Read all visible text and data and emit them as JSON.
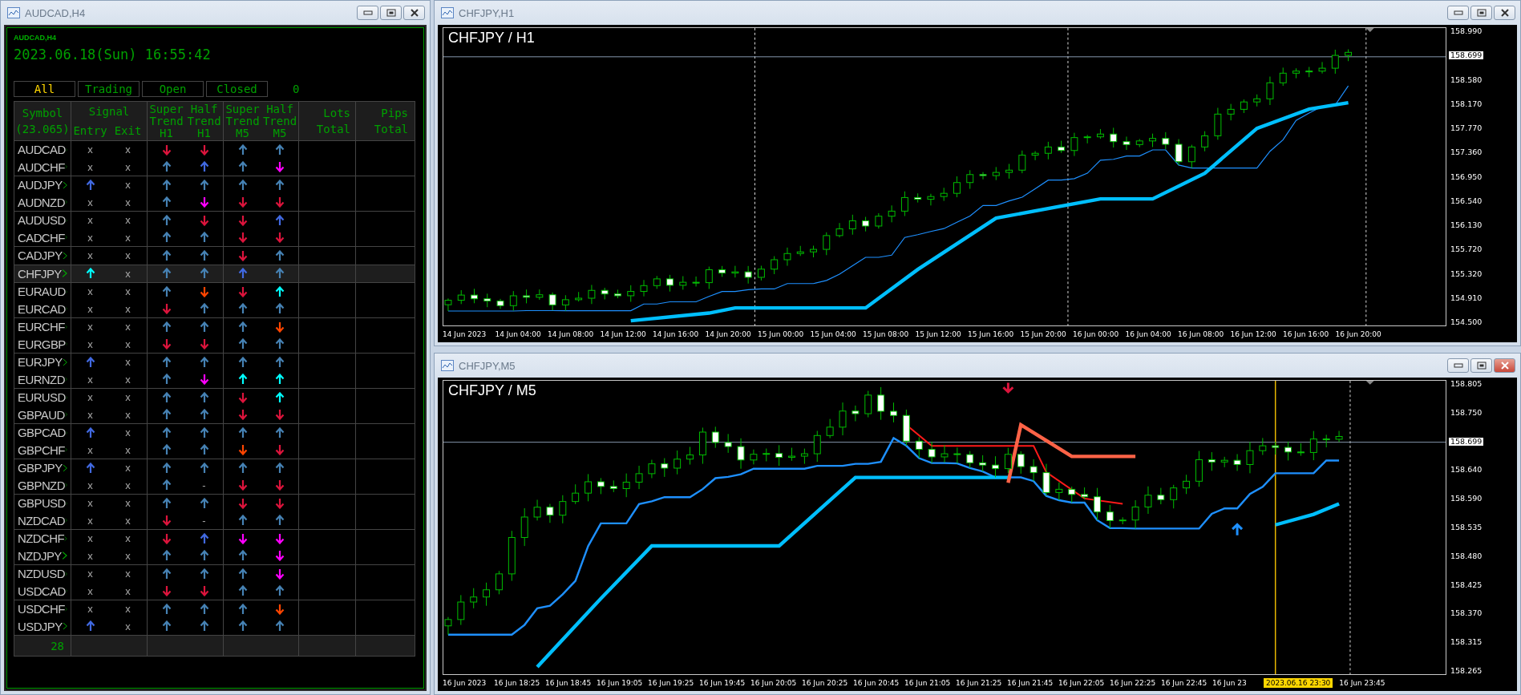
{
  "dashboard_window": {
    "title": "AUDCAD,H4",
    "caption": "AUDCAD,H4",
    "datetime": "2023.06.18(Sun) 16:55:42",
    "tabs": [
      {
        "label": "All",
        "selected": true
      },
      {
        "label": "Trading",
        "selected": false
      },
      {
        "label": "Open",
        "selected": false
      },
      {
        "label": "Closed",
        "selected": false
      }
    ],
    "count": "0",
    "table": {
      "header": {
        "symbol": [
          "Symbol",
          "(23.065)"
        ],
        "signal": "Signal",
        "signal_sub": [
          "Entry",
          "Exit"
        ],
        "indicators": [
          [
            "Super",
            "Trend",
            "H1"
          ],
          [
            "Half",
            "Trend",
            "H1"
          ],
          [
            "Super",
            "Trend",
            "M5"
          ],
          [
            "Half",
            "Trend",
            "M5"
          ]
        ],
        "totals": [
          [
            "Lots",
            "Total"
          ],
          [
            "Pips",
            "Total"
          ]
        ]
      },
      "groups": [
        {
          "rows": [
            {
              "symbol": "AUDCAD",
              "selected": false,
              "cells": [
                {
                  "kind": "text",
                  "text": "x"
                },
                {
                  "kind": "text",
                  "text": "x"
                },
                {
                  "kind": "down",
                  "color": "#dc143c"
                },
                {
                  "kind": "down",
                  "color": "#dc143c"
                },
                {
                  "kind": "up",
                  "color": "#4682b4"
                },
                {
                  "kind": "up",
                  "color": "#4682b4"
                }
              ]
            },
            {
              "symbol": "AUDCHF",
              "selected": false,
              "cells": [
                {
                  "kind": "text",
                  "text": "x"
                },
                {
                  "kind": "text",
                  "text": "x"
                },
                {
                  "kind": "up",
                  "color": "#4682b4"
                },
                {
                  "kind": "up",
                  "color": "#4169e1"
                },
                {
                  "kind": "up",
                  "color": "#4682b4"
                },
                {
                  "kind": "down",
                  "color": "#ff00ff"
                }
              ]
            }
          ]
        },
        {
          "rows": [
            {
              "symbol": "AUDJPY",
              "selected": false,
              "cells": [
                {
                  "kind": "up",
                  "color": "#4169e1"
                },
                {
                  "kind": "text",
                  "text": "x"
                },
                {
                  "kind": "up",
                  "color": "#4682b4"
                },
                {
                  "kind": "up",
                  "color": "#4682b4"
                },
                {
                  "kind": "up",
                  "color": "#4682b4"
                },
                {
                  "kind": "up",
                  "color": "#4682b4"
                }
              ]
            },
            {
              "symbol": "AUDNZD",
              "selected": false,
              "cells": [
                {
                  "kind": "text",
                  "text": "x"
                },
                {
                  "kind": "text",
                  "text": "x"
                },
                {
                  "kind": "up",
                  "color": "#4682b4"
                },
                {
                  "kind": "down",
                  "color": "#ff00ff"
                },
                {
                  "kind": "down",
                  "color": "#dc143c"
                },
                {
                  "kind": "down",
                  "color": "#dc143c"
                }
              ]
            }
          ]
        },
        {
          "rows": [
            {
              "symbol": "AUDUSD",
              "selected": false,
              "cells": [
                {
                  "kind": "text",
                  "text": "x"
                },
                {
                  "kind": "text",
                  "text": "x"
                },
                {
                  "kind": "up",
                  "color": "#4682b4"
                },
                {
                  "kind": "down",
                  "color": "#dc143c"
                },
                {
                  "kind": "down",
                  "color": "#dc143c"
                },
                {
                  "kind": "up",
                  "color": "#4169e1"
                }
              ]
            },
            {
              "symbol": "CADCHF",
              "selected": false,
              "cells": [
                {
                  "kind": "text",
                  "text": "x"
                },
                {
                  "kind": "text",
                  "text": "x"
                },
                {
                  "kind": "up",
                  "color": "#4682b4"
                },
                {
                  "kind": "up",
                  "color": "#4682b4"
                },
                {
                  "kind": "down",
                  "color": "#dc143c"
                },
                {
                  "kind": "down",
                  "color": "#dc143c"
                }
              ]
            }
          ]
        },
        {
          "rows": [
            {
              "symbol": "CADJPY",
              "selected": false,
              "cells": [
                {
                  "kind": "text",
                  "text": "x"
                },
                {
                  "kind": "text",
                  "text": "x"
                },
                {
                  "kind": "up",
                  "color": "#4682b4"
                },
                {
                  "kind": "up",
                  "color": "#4682b4"
                },
                {
                  "kind": "down",
                  "color": "#dc143c"
                },
                {
                  "kind": "up",
                  "color": "#4682b4"
                }
              ]
            }
          ]
        },
        {
          "rows": [
            {
              "symbol": "CHFJPY",
              "selected": true,
              "cells": [
                {
                  "kind": "up",
                  "color": "#00ffff"
                },
                {
                  "kind": "text",
                  "text": "x"
                },
                {
                  "kind": "up",
                  "color": "#4682b4"
                },
                {
                  "kind": "up",
                  "color": "#4682b4"
                },
                {
                  "kind": "up",
                  "color": "#4169e1"
                },
                {
                  "kind": "up",
                  "color": "#4682b4"
                }
              ]
            }
          ]
        },
        {
          "rows": [
            {
              "symbol": "EURAUD",
              "selected": false,
              "cells": [
                {
                  "kind": "text",
                  "text": "x"
                },
                {
                  "kind": "text",
                  "text": "x"
                },
                {
                  "kind": "up",
                  "color": "#4682b4"
                },
                {
                  "kind": "down",
                  "color": "#ff4500"
                },
                {
                  "kind": "down",
                  "color": "#dc143c"
                },
                {
                  "kind": "up",
                  "color": "#00ffff"
                }
              ]
            },
            {
              "symbol": "EURCAD",
              "selected": false,
              "cells": [
                {
                  "kind": "text",
                  "text": "x"
                },
                {
                  "kind": "text",
                  "text": "x"
                },
                {
                  "kind": "down",
                  "color": "#dc143c"
                },
                {
                  "kind": "up",
                  "color": "#4682b4"
                },
                {
                  "kind": "up",
                  "color": "#4682b4"
                },
                {
                  "kind": "up",
                  "color": "#4682b4"
                }
              ]
            }
          ]
        },
        {
          "rows": [
            {
              "symbol": "EURCHF",
              "selected": false,
              "cells": [
                {
                  "kind": "text",
                  "text": "x"
                },
                {
                  "kind": "text",
                  "text": "x"
                },
                {
                  "kind": "up",
                  "color": "#4682b4"
                },
                {
                  "kind": "up",
                  "color": "#4682b4"
                },
                {
                  "kind": "up",
                  "color": "#4682b4"
                },
                {
                  "kind": "down",
                  "color": "#ff4500"
                }
              ]
            },
            {
              "symbol": "EURGBP",
              "selected": false,
              "cells": [
                {
                  "kind": "text",
                  "text": "x"
                },
                {
                  "kind": "text",
                  "text": "x"
                },
                {
                  "kind": "down",
                  "color": "#dc143c"
                },
                {
                  "kind": "down",
                  "color": "#dc143c"
                },
                {
                  "kind": "up",
                  "color": "#4682b4"
                },
                {
                  "kind": "up",
                  "color": "#4682b4"
                }
              ]
            }
          ]
        },
        {
          "rows": [
            {
              "symbol": "EURJPY",
              "selected": false,
              "cells": [
                {
                  "kind": "up",
                  "color": "#4169e1"
                },
                {
                  "kind": "text",
                  "text": "x"
                },
                {
                  "kind": "up",
                  "color": "#4682b4"
                },
                {
                  "kind": "up",
                  "color": "#4682b4"
                },
                {
                  "kind": "up",
                  "color": "#4682b4"
                },
                {
                  "kind": "up",
                  "color": "#4682b4"
                }
              ]
            },
            {
              "symbol": "EURNZD",
              "selected": false,
              "cells": [
                {
                  "kind": "text",
                  "text": "x"
                },
                {
                  "kind": "text",
                  "text": "x"
                },
                {
                  "kind": "up",
                  "color": "#4682b4"
                },
                {
                  "kind": "down",
                  "color": "#ff00ff"
                },
                {
                  "kind": "up",
                  "color": "#00ffff"
                },
                {
                  "kind": "up",
                  "color": "#00ffff"
                }
              ]
            }
          ]
        },
        {
          "rows": [
            {
              "symbol": "EURUSD",
              "selected": false,
              "cells": [
                {
                  "kind": "text",
                  "text": "x"
                },
                {
                  "kind": "text",
                  "text": "x"
                },
                {
                  "kind": "up",
                  "color": "#4682b4"
                },
                {
                  "kind": "up",
                  "color": "#4682b4"
                },
                {
                  "kind": "down",
                  "color": "#dc143c"
                },
                {
                  "kind": "up",
                  "color": "#00ffff"
                }
              ]
            },
            {
              "symbol": "GBPAUD",
              "selected": false,
              "cells": [
                {
                  "kind": "text",
                  "text": "x"
                },
                {
                  "kind": "text",
                  "text": "x"
                },
                {
                  "kind": "up",
                  "color": "#4682b4"
                },
                {
                  "kind": "up",
                  "color": "#4682b4"
                },
                {
                  "kind": "down",
                  "color": "#dc143c"
                },
                {
                  "kind": "down",
                  "color": "#dc143c"
                }
              ]
            }
          ]
        },
        {
          "rows": [
            {
              "symbol": "GBPCAD",
              "selected": false,
              "cells": [
                {
                  "kind": "up",
                  "color": "#4169e1"
                },
                {
                  "kind": "text",
                  "text": "x"
                },
                {
                  "kind": "up",
                  "color": "#4682b4"
                },
                {
                  "kind": "up",
                  "color": "#4682b4"
                },
                {
                  "kind": "up",
                  "color": "#4682b4"
                },
                {
                  "kind": "up",
                  "color": "#4682b4"
                }
              ]
            },
            {
              "symbol": "GBPCHF",
              "selected": false,
              "cells": [
                {
                  "kind": "text",
                  "text": "x"
                },
                {
                  "kind": "text",
                  "text": "x"
                },
                {
                  "kind": "up",
                  "color": "#4682b4"
                },
                {
                  "kind": "up",
                  "color": "#4682b4"
                },
                {
                  "kind": "down",
                  "color": "#ff4500"
                },
                {
                  "kind": "down",
                  "color": "#dc143c"
                }
              ]
            }
          ]
        },
        {
          "rows": [
            {
              "symbol": "GBPJPY",
              "selected": false,
              "cells": [
                {
                  "kind": "up",
                  "color": "#4169e1"
                },
                {
                  "kind": "text",
                  "text": "x"
                },
                {
                  "kind": "up",
                  "color": "#4682b4"
                },
                {
                  "kind": "up",
                  "color": "#4682b4"
                },
                {
                  "kind": "up",
                  "color": "#4682b4"
                },
                {
                  "kind": "up",
                  "color": "#4682b4"
                }
              ]
            },
            {
              "symbol": "GBPNZD",
              "selected": false,
              "cells": [
                {
                  "kind": "text",
                  "text": "x"
                },
                {
                  "kind": "text",
                  "text": "x"
                },
                {
                  "kind": "up",
                  "color": "#4682b4"
                },
                {
                  "kind": "text",
                  "text": "-"
                },
                {
                  "kind": "down",
                  "color": "#dc143c"
                },
                {
                  "kind": "down",
                  "color": "#dc143c"
                }
              ]
            }
          ]
        },
        {
          "rows": [
            {
              "symbol": "GBPUSD",
              "selected": false,
              "cells": [
                {
                  "kind": "text",
                  "text": "x"
                },
                {
                  "kind": "text",
                  "text": "x"
                },
                {
                  "kind": "up",
                  "color": "#4682b4"
                },
                {
                  "kind": "up",
                  "color": "#4682b4"
                },
                {
                  "kind": "down",
                  "color": "#dc143c"
                },
                {
                  "kind": "down",
                  "color": "#dc143c"
                }
              ]
            },
            {
              "symbol": "NZDCAD",
              "selected": false,
              "cells": [
                {
                  "kind": "text",
                  "text": "x"
                },
                {
                  "kind": "text",
                  "text": "x"
                },
                {
                  "kind": "down",
                  "color": "#dc143c"
                },
                {
                  "kind": "text",
                  "text": "-"
                },
                {
                  "kind": "up",
                  "color": "#4682b4"
                },
                {
                  "kind": "up",
                  "color": "#4682b4"
                }
              ]
            }
          ]
        },
        {
          "rows": [
            {
              "symbol": "NZDCHF",
              "selected": false,
              "cells": [
                {
                  "kind": "text",
                  "text": "x"
                },
                {
                  "kind": "text",
                  "text": "x"
                },
                {
                  "kind": "down",
                  "color": "#dc143c"
                },
                {
                  "kind": "up",
                  "color": "#4169e1"
                },
                {
                  "kind": "down",
                  "color": "#ff00ff"
                },
                {
                  "kind": "down",
                  "color": "#ff00ff"
                }
              ]
            },
            {
              "symbol": "NZDJPY",
              "selected": false,
              "cells": [
                {
                  "kind": "text",
                  "text": "x"
                },
                {
                  "kind": "text",
                  "text": "x"
                },
                {
                  "kind": "up",
                  "color": "#4682b4"
                },
                {
                  "kind": "up",
                  "color": "#4682b4"
                },
                {
                  "kind": "up",
                  "color": "#4682b4"
                },
                {
                  "kind": "down",
                  "color": "#ff00ff"
                }
              ]
            }
          ]
        },
        {
          "rows": [
            {
              "symbol": "NZDUSD",
              "selected": false,
              "cells": [
                {
                  "kind": "text",
                  "text": "x"
                },
                {
                  "kind": "text",
                  "text": "x"
                },
                {
                  "kind": "up",
                  "color": "#4682b4"
                },
                {
                  "kind": "up",
                  "color": "#4682b4"
                },
                {
                  "kind": "up",
                  "color": "#4682b4"
                },
                {
                  "kind": "down",
                  "color": "#ff00ff"
                }
              ]
            },
            {
              "symbol": "USDCAD",
              "selected": false,
              "cells": [
                {
                  "kind": "text",
                  "text": "x"
                },
                {
                  "kind": "text",
                  "text": "x"
                },
                {
                  "kind": "down",
                  "color": "#dc143c"
                },
                {
                  "kind": "down",
                  "color": "#dc143c"
                },
                {
                  "kind": "up",
                  "color": "#4682b4"
                },
                {
                  "kind": "up",
                  "color": "#4682b4"
                }
              ]
            }
          ]
        },
        {
          "rows": [
            {
              "symbol": "USDCHF",
              "selected": false,
              "cells": [
                {
                  "kind": "text",
                  "text": "x"
                },
                {
                  "kind": "text",
                  "text": "x"
                },
                {
                  "kind": "up",
                  "color": "#4682b4"
                },
                {
                  "kind": "up",
                  "color": "#4682b4"
                },
                {
                  "kind": "up",
                  "color": "#4682b4"
                },
                {
                  "kind": "down",
                  "color": "#ff4500"
                }
              ]
            },
            {
              "symbol": "USDJPY",
              "selected": false,
              "cells": [
                {
                  "kind": "up",
                  "color": "#4169e1"
                },
                {
                  "kind": "text",
                  "text": "x"
                },
                {
                  "kind": "up",
                  "color": "#4682b4"
                },
                {
                  "kind": "up",
                  "color": "#4682b4"
                },
                {
                  "kind": "up",
                  "color": "#4682b4"
                },
                {
                  "kind": "up",
                  "color": "#4682b4"
                }
              ]
            }
          ]
        }
      ],
      "footer_count": "28"
    }
  },
  "chart_windows": [
    {
      "title": "CHFJPY,H1",
      "label": "CHFJPY / H1",
      "active": false,
      "kind": "hourly",
      "price_axis": [
        {
          "kind": "tick",
          "text": "158.990"
        },
        {
          "kind": "current",
          "text": "158.699"
        },
        {
          "kind": "tick",
          "text": "158.580"
        },
        {
          "kind": "tick",
          "text": "158.170"
        },
        {
          "kind": "tick",
          "text": "157.770"
        },
        {
          "kind": "tick",
          "text": "157.360"
        },
        {
          "kind": "tick",
          "text": "156.950"
        },
        {
          "kind": "tick",
          "text": "156.540"
        },
        {
          "kind": "tick",
          "text": "156.130"
        },
        {
          "kind": "tick",
          "text": "155.720"
        },
        {
          "kind": "tick",
          "text": "155.320"
        },
        {
          "kind": "tick",
          "text": "154.910"
        },
        {
          "kind": "tick",
          "text": "154.500"
        }
      ],
      "time_axis": [
        {
          "text": "14 Jun 2023",
          "highlighted": false
        },
        {
          "text": "14 Jun 04:00",
          "highlighted": false
        },
        {
          "text": "14 Jun 08:00",
          "highlighted": false
        },
        {
          "text": "14 Jun 12:00",
          "highlighted": false
        },
        {
          "text": "14 Jun 16:00",
          "highlighted": false
        },
        {
          "text": "14 Jun 20:00",
          "highlighted": false
        },
        {
          "text": "15 Jun 00:00",
          "highlighted": false
        },
        {
          "text": "15 Jun 04:00",
          "highlighted": false
        },
        {
          "text": "15 Jun 08:00",
          "highlighted": false
        },
        {
          "text": "15 Jun 12:00",
          "highlighted": false
        },
        {
          "text": "15 Jun 16:00",
          "highlighted": false
        },
        {
          "text": "15 Jun 20:00",
          "highlighted": false
        },
        {
          "text": "16 Jun 00:00",
          "highlighted": false
        },
        {
          "text": "16 Jun 04:00",
          "highlighted": false
        },
        {
          "text": "16 Jun 08:00",
          "highlighted": false
        },
        {
          "text": "16 Jun 12:00",
          "highlighted": false
        },
        {
          "text": "16 Jun 16:00",
          "highlighted": false
        },
        {
          "text": "16 Jun 20:00",
          "highlighted": false
        }
      ]
    },
    {
      "title": "CHFJPY,M5",
      "label": "CHFJPY / M5",
      "active": true,
      "kind": "minutes",
      "price_axis": [
        {
          "kind": "tick",
          "text": "158.805"
        },
        {
          "kind": "tick",
          "text": "158.750"
        },
        {
          "kind": "current",
          "text": "158.699"
        },
        {
          "kind": "tick",
          "text": "158.640"
        },
        {
          "kind": "tick",
          "text": "158.590"
        },
        {
          "kind": "tick",
          "text": "158.535"
        },
        {
          "kind": "tick",
          "text": "158.480"
        },
        {
          "kind": "tick",
          "text": "158.425"
        },
        {
          "kind": "tick",
          "text": "158.370"
        },
        {
          "kind": "tick",
          "text": "158.315"
        },
        {
          "kind": "tick",
          "text": "158.265"
        }
      ],
      "time_axis": [
        {
          "text": "16 Jun 2023",
          "highlighted": false
        },
        {
          "text": "16 Jun 18:25",
          "highlighted": false
        },
        {
          "text": "16 Jun 18:45",
          "highlighted": false
        },
        {
          "text": "16 Jun 19:05",
          "highlighted": false
        },
        {
          "text": "16 Jun 19:25",
          "highlighted": false
        },
        {
          "text": "16 Jun 19:45",
          "highlighted": false
        },
        {
          "text": "16 Jun 20:05",
          "highlighted": false
        },
        {
          "text": "16 Jun 20:25",
          "highlighted": false
        },
        {
          "text": "16 Jun 20:45",
          "highlighted": false
        },
        {
          "text": "16 Jun 21:05",
          "highlighted": false
        },
        {
          "text": "16 Jun 21:25",
          "highlighted": false
        },
        {
          "text": "16 Jun 21:45",
          "highlighted": false
        },
        {
          "text": "16 Jun 22:05",
          "highlighted": false
        },
        {
          "text": "16 Jun 22:25",
          "highlighted": false
        },
        {
          "text": "16 Jun 22:45",
          "highlighted": false
        },
        {
          "text": "16 Jun 23",
          "highlighted": false
        },
        {
          "text": "2023.06.16 23:30",
          "highlighted": true
        },
        {
          "text": "16 Jun 23:45",
          "highlighted": false
        }
      ]
    }
  ]
}
